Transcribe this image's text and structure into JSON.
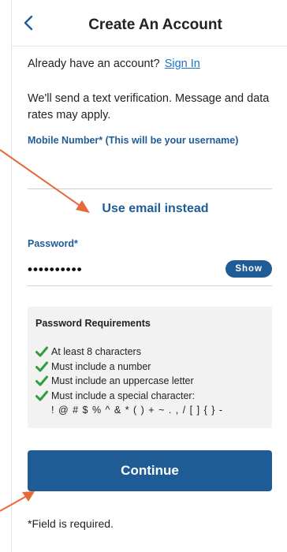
{
  "header": {
    "title": "Create An Account",
    "back_icon": "chevron-left-icon"
  },
  "account_prompt": {
    "text": "Already have an account?",
    "link": "Sign In"
  },
  "sms_notice": "We'll send a text verification. Message and data rates may apply.",
  "mobile": {
    "label": "Mobile Number* (This will be your username)",
    "value": ""
  },
  "use_email_label": "Use email instead",
  "password": {
    "label": "Password*",
    "value": "••••••••••",
    "show_label": "Show"
  },
  "requirements": {
    "title": "Password Requirements",
    "items": [
      "At least 8 characters",
      "Must include a number",
      "Must include an uppercase letter",
      "Must include a special character:"
    ],
    "special_chars": "! @ # $ % ^ & * ( ) + ~ . , / [ ] { } -",
    "check_icon": "checkmark-icon"
  },
  "continue_label": "Continue",
  "required_note": "*Field is required.",
  "colors": {
    "primary": "#1f5c96",
    "link": "#1a73c9",
    "check": "#2e9e3e",
    "annotation_arrow": "#e8683a"
  }
}
